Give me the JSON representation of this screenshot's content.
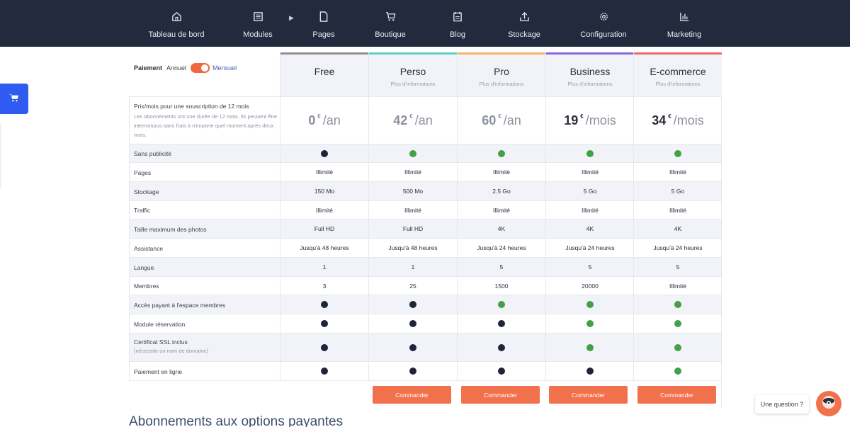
{
  "nav": {
    "items": [
      {
        "label": "Tableau de bord",
        "icon": "home-icon"
      },
      {
        "label": "Modules",
        "icon": "modules-icon"
      },
      {
        "label": "Pages",
        "icon": "page-icon"
      },
      {
        "label": "Boutique",
        "icon": "cart-icon"
      },
      {
        "label": "Blog",
        "icon": "blog-icon"
      },
      {
        "label": "Stockage",
        "icon": "upload-icon"
      },
      {
        "label": "Configuration",
        "icon": "gear-icon"
      },
      {
        "label": "Marketing",
        "icon": "chart-icon"
      }
    ]
  },
  "billing": {
    "label": "Paiement",
    "option_annual": "Annuel",
    "option_monthly": "Mensuel",
    "monthly_selected": true
  },
  "plans": [
    {
      "name": "Free",
      "info": "",
      "color": "#8e8e96"
    },
    {
      "name": "Perso",
      "info": "Plus d'informations",
      "color": "#5fd0c2"
    },
    {
      "name": "Pro",
      "info": "Plus d'informations",
      "color": "#f6b36b"
    },
    {
      "name": "Business",
      "info": "Plus d'informations",
      "color": "#8b65d9"
    },
    {
      "name": "E-commerce",
      "info": "Plus d'informations",
      "color": "#f06a6a"
    }
  ],
  "price_row": {
    "label": "Prix/mois pour une souscription de 12 mois",
    "note": "Les abonnements ont une durée de 12 mois. Ils peuvent être interrompus sans frais à n'importe quel moment après deux mois.",
    "prices": [
      {
        "amount": "0",
        "currency": "€",
        "period": "/an"
      },
      {
        "amount": "42",
        "currency": "€",
        "period": "/an"
      },
      {
        "amount": "60",
        "currency": "€",
        "period": "/an"
      },
      {
        "amount": "19",
        "currency": "€",
        "period": "/mois"
      },
      {
        "amount": "34",
        "currency": "€",
        "period": "/mois"
      }
    ]
  },
  "colors": {
    "dot_yes": "#43a047",
    "dot_no": "#1f2538"
  },
  "features": [
    {
      "label": "Sans publicité",
      "type": "dot",
      "values": [
        false,
        true,
        true,
        true,
        true
      ]
    },
    {
      "label": "Pages",
      "type": "text",
      "values": [
        "Illimité",
        "Illimité",
        "Illimité",
        "Illimité",
        "Illimité"
      ]
    },
    {
      "label": "Stockage",
      "type": "text",
      "values": [
        "150 Mo",
        "500 Mo",
        "2.5 Go",
        "5 Go",
        "5 Go"
      ]
    },
    {
      "label": "Traffic",
      "type": "text",
      "values": [
        "Illimité",
        "Illimité",
        "Illimité",
        "Illimité",
        "Illimité"
      ]
    },
    {
      "label": "Taille maximum des photos",
      "type": "text",
      "values": [
        "Full HD",
        "Full HD",
        "4K",
        "4K",
        "4K"
      ]
    },
    {
      "label": "Assistance",
      "type": "text",
      "values": [
        "Jusqu'à 48 heures",
        "Jusqu'à 48 heures",
        "Jusqu'à 24 heures",
        "Jusqu'à 24 heures",
        "Jusqu'à 24 heures"
      ]
    },
    {
      "label": "Langue",
      "type": "text",
      "values": [
        "1",
        "1",
        "5",
        "5",
        "5"
      ]
    },
    {
      "label": "Membres",
      "type": "text",
      "values": [
        "3",
        "25",
        "1500",
        "20000",
        "Illimité"
      ]
    },
    {
      "label": "Accès payant à l'espace membres",
      "type": "dot",
      "values": [
        false,
        false,
        true,
        true,
        true
      ]
    },
    {
      "label": "Module réservation",
      "type": "dot",
      "values": [
        false,
        false,
        false,
        true,
        true
      ]
    },
    {
      "label": "Certificat SSL inclus",
      "sub": "(nécessite un nom de domaine)",
      "type": "dot",
      "values": [
        false,
        false,
        false,
        true,
        true
      ]
    },
    {
      "label": "Paiement en ligne",
      "type": "dot",
      "values": [
        false,
        false,
        false,
        false,
        true
      ]
    }
  ],
  "order_label": "Commander",
  "section_title": "Abonnements aux options payantes",
  "help": {
    "label": "Une question ?"
  }
}
